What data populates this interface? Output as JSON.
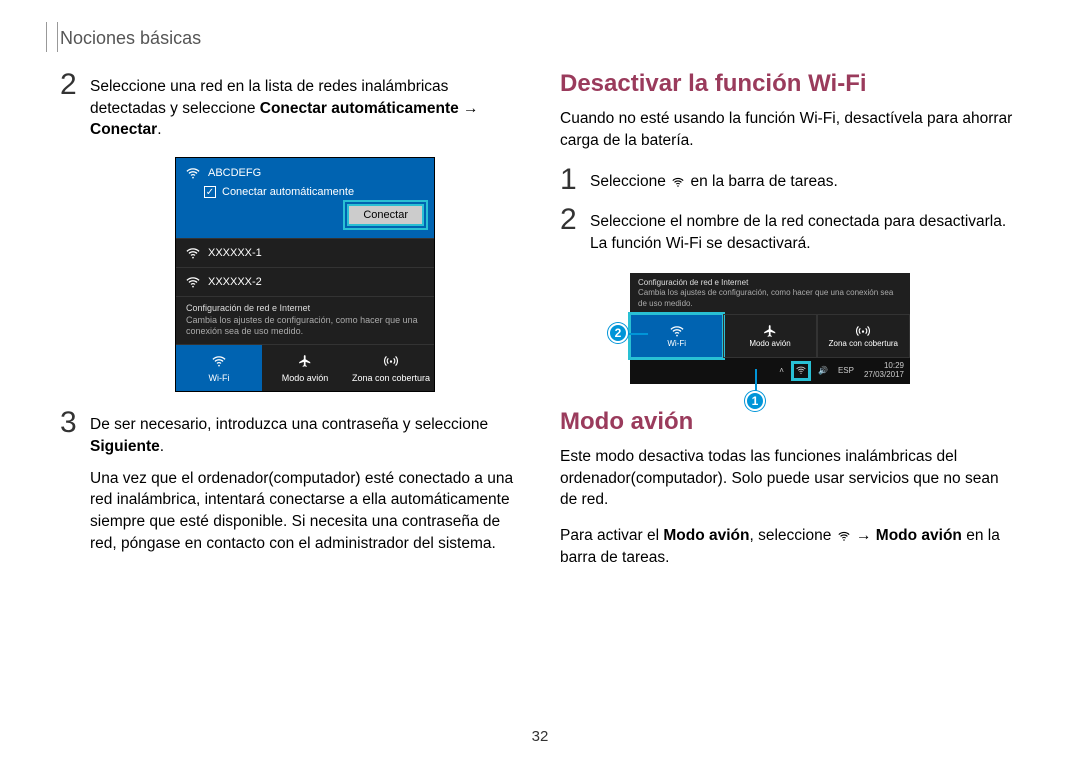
{
  "header": "Nociones básicas",
  "page_number": "32",
  "left": {
    "step2": {
      "text_a": "Seleccione una red en la lista de redes inalámbricas detectadas y seleccione ",
      "bold_a": "Conectar automáticamente",
      "arrow": " → ",
      "bold_b": "Conectar",
      "tail": "."
    },
    "step3": {
      "line1_a": "De ser necesario, introduzca una contraseña y seleccione ",
      "bold": "Siguiente",
      "tail": ".",
      "para": "Una vez que el ordenador(computador) esté conectado a una red inalámbrica, intentará conectarse a ella automáticamente siempre que esté disponible. Si necesita una contraseña de red, póngase en contacto con el administrador del sistema."
    },
    "shot1": {
      "ssid_main": "ABCDEFG",
      "auto": "Conectar automáticamente",
      "connect": "Conectar",
      "ssid1": "XXXXXX-1",
      "ssid2": "XXXXXX-2",
      "cfg_title": "Configuración de red e Internet",
      "cfg_sub": "Cambia los ajustes de configuración, como hacer que una conexión sea de uso medido.",
      "tile_wifi": "Wi-Fi",
      "tile_plane": "Modo avión",
      "tile_zone": "Zona con cobertura"
    }
  },
  "right": {
    "h_deact": "Desactivar la función Wi-Fi",
    "deact_intro": "Cuando no esté usando la función Wi-Fi, desactívela para ahorrar carga de la batería.",
    "step1_a": "Seleccione ",
    "step1_b": " en la barra de tareas.",
    "step2": "Seleccione el nombre de la red conectada para desactivarla. La función Wi-Fi se desactivará.",
    "shot2": {
      "cfg_title": "Configuración de red e Internet",
      "cfg_sub": "Cambia los ajustes de configuración, como hacer que una conexión sea de uso medido.",
      "tile_wifi": "Wi-Fi",
      "tile_plane": "Modo avión",
      "tile_zone": "Zona con cobertura",
      "callout1": "1",
      "callout2": "2",
      "tray_lang": "ESP",
      "tray_time": "10:29",
      "tray_date": "27/03/2017"
    },
    "h_plane": "Modo avión",
    "plane_p1": "Este modo desactiva todas las funciones inalámbricas del ordenador(computador). Solo puede usar servicios que no sean de red.",
    "plane_p2_a": "Para activar el ",
    "plane_p2_bold1": "Modo avión",
    "plane_p2_b": ", seleccione ",
    "plane_p2_arrow": " → ",
    "plane_p2_bold2": "Modo avión",
    "plane_p2_c": " en la barra de tareas."
  }
}
